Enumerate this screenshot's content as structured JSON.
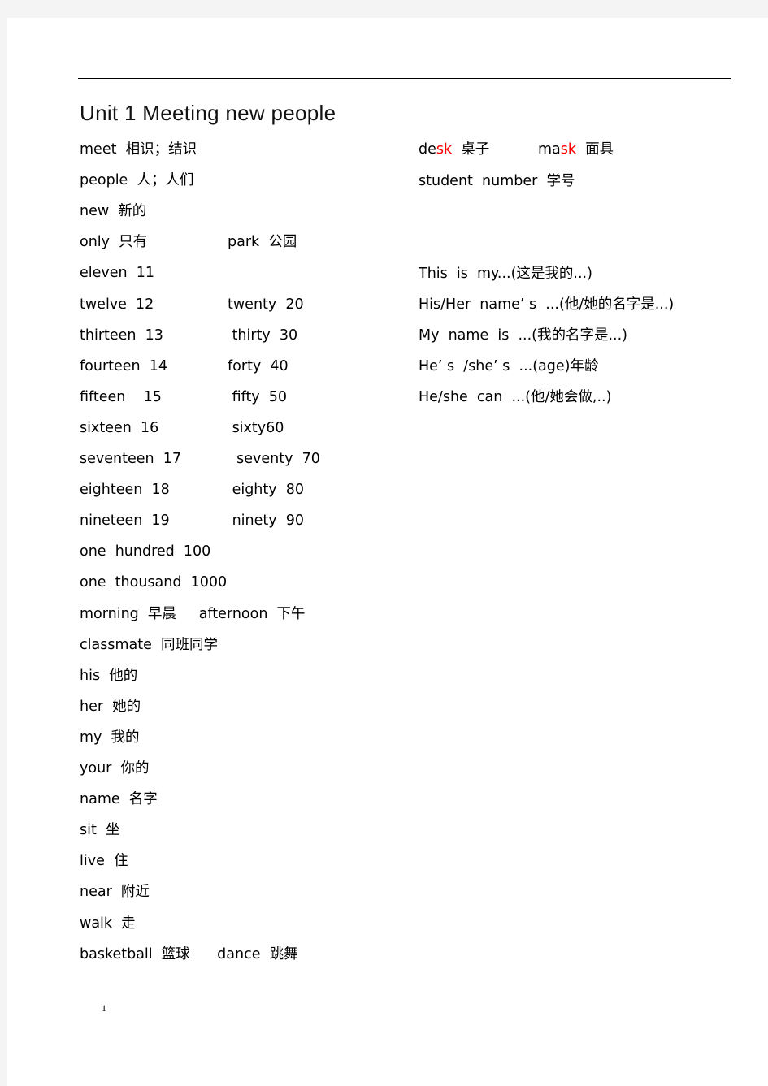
{
  "document": {
    "title": "Unit 1 Meeting new people",
    "page_number": "1",
    "accent_color": "#ff0000",
    "left_column": [
      {
        "a": "meet  相识；结识",
        "b": ""
      },
      {
        "a": "people  人；人们",
        "b": ""
      },
      {
        "a": "new  新的",
        "b": ""
      },
      {
        "a": "only  只有",
        "b": "park  公园"
      },
      {
        "a": "eleven  11",
        "b": ""
      },
      {
        "a": "twelve  12",
        "b": "twenty  20"
      },
      {
        "a": "thirteen  13",
        "b": " thirty  30"
      },
      {
        "a": "fourteen  14",
        "b": "forty  40"
      },
      {
        "a": "fifteen    15",
        "b": " fifty  50"
      },
      {
        "a": "sixteen  16",
        "b": " sixty60"
      },
      {
        "a": "seventeen  17",
        "b": "  seventy  70"
      },
      {
        "a": "eighteen  18",
        "b": " eighty  80"
      },
      {
        "a": "nineteen  19",
        "b": " ninety  90"
      },
      {
        "a": "one  hundred  100",
        "b": ""
      },
      {
        "a": "one  thousand  1000",
        "b": ""
      },
      {
        "a": "morning  早晨     afternoon  下午",
        "b": ""
      },
      {
        "a": "classmate  同班同学",
        "b": ""
      },
      {
        "a": "his  他的",
        "b": ""
      },
      {
        "a": "her  她的",
        "b": ""
      },
      {
        "a": "my  我的",
        "b": ""
      },
      {
        "a": "your  你的",
        "b": ""
      },
      {
        "a": "name  名字",
        "b": ""
      },
      {
        "a": "sit  坐",
        "b": ""
      },
      {
        "a": "live  住",
        "b": ""
      },
      {
        "a": "near  附近",
        "b": ""
      },
      {
        "a": "walk  走",
        "b": ""
      },
      {
        "a": "basketball  篮球      dance  跳舞",
        "b": ""
      }
    ],
    "right_column": {
      "desk": {
        "prefix": "de",
        "highlight": "sk",
        "meaning": "  桌子"
      },
      "mask": {
        "prefix": "ma",
        "highlight": "sk",
        "meaning": "  面具"
      },
      "student_number": "student  number  学号",
      "phrases": [
        "This  is  my...(这是我的...)",
        "His/Her  name’ s  ...(他/她的名字是...)",
        "My  name  is  ...(我的名字是...)",
        "He’ s  /she’ s  ...(age)年龄",
        "He/she  can  ...(他/她会做,..)"
      ]
    }
  }
}
